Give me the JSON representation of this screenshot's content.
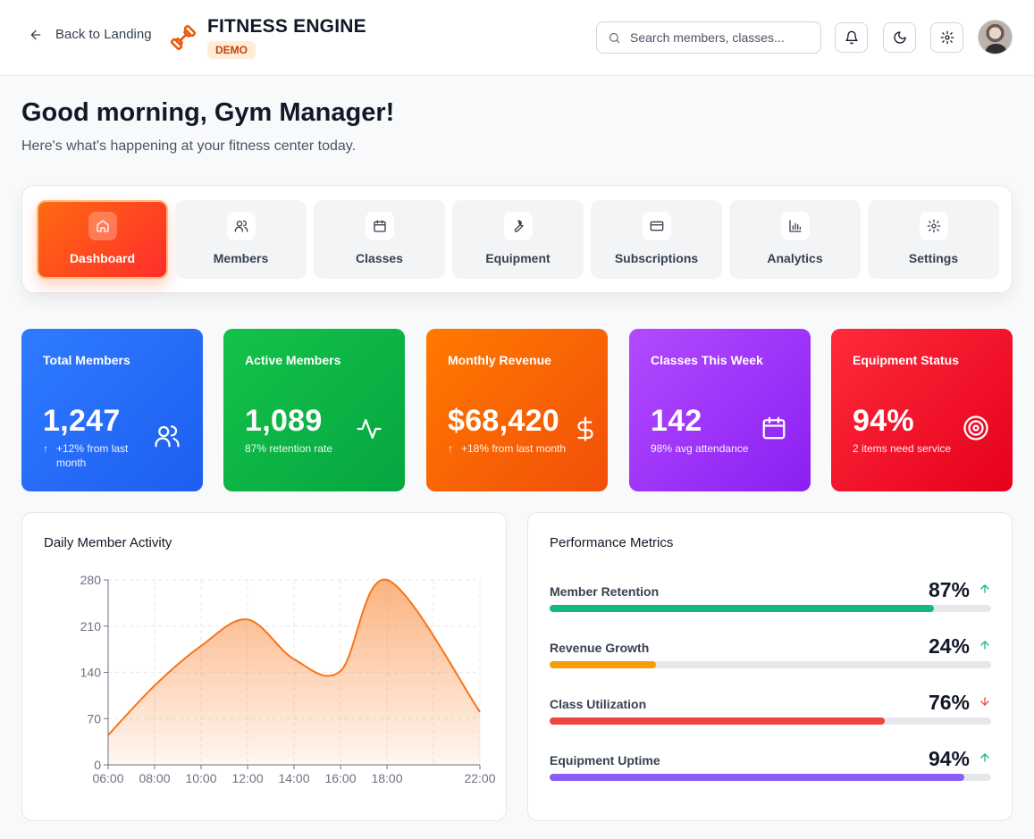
{
  "header": {
    "back_label": "Back to Landing",
    "brand_name": "FITNESS ENGINE",
    "badge": "DEMO",
    "search_placeholder": "Search members, classes...",
    "icons": [
      "bell-icon",
      "moon-icon",
      "gear-icon"
    ]
  },
  "greeting": {
    "title": "Good morning, Gym Manager!",
    "subtitle": "Here's what's happening at your fitness center today."
  },
  "tabs": [
    {
      "label": "Dashboard",
      "icon": "home-icon",
      "active": true
    },
    {
      "label": "Members",
      "icon": "users-icon",
      "active": false
    },
    {
      "label": "Classes",
      "icon": "calendar-icon",
      "active": false
    },
    {
      "label": "Equipment",
      "icon": "wrench-icon",
      "active": false
    },
    {
      "label": "Subscriptions",
      "icon": "credit-card-icon",
      "active": false
    },
    {
      "label": "Analytics",
      "icon": "bar-chart-icon",
      "active": false
    },
    {
      "label": "Settings",
      "icon": "gear-icon",
      "active": false
    }
  ],
  "stats": [
    {
      "title": "Total Members",
      "value": "1,247",
      "sub": "+12% from last month",
      "icon": "users-icon",
      "colors": [
        "#2f7bff",
        "#1d5ef0"
      ]
    },
    {
      "title": "Active Members",
      "value": "1,089",
      "sub": "87% retention rate",
      "icon": "activity-icon",
      "colors": [
        "#14c24a",
        "#05a640"
      ]
    },
    {
      "title": "Monthly Revenue",
      "value": "$68,420",
      "sub": "+18% from last month",
      "icon": "dollar-icon",
      "colors": [
        "#ff7a00",
        "#f24f09"
      ]
    },
    {
      "title": "Classes This Week",
      "value": "142",
      "sub": "98% avg attendance",
      "icon": "calendar-icon",
      "colors": [
        "#b24bff",
        "#8b1ff2"
      ]
    },
    {
      "title": "Equipment Status",
      "value": "94%",
      "sub": "2 items need service",
      "icon": "target-icon",
      "colors": [
        "#ff2a3a",
        "#e6001c"
      ]
    }
  ],
  "activity": {
    "title": "Daily Member Activity"
  },
  "chart_data": {
    "type": "area",
    "title": "Daily Member Activity",
    "xlabel": "",
    "ylabel": "",
    "x": [
      "06:00",
      "08:00",
      "10:00",
      "12:00",
      "14:00",
      "16:00",
      "18:00",
      "22:00"
    ],
    "x_hours": [
      6,
      8,
      10,
      12,
      14,
      16,
      18,
      22
    ],
    "values": [
      45,
      120,
      180,
      220,
      160,
      142,
      280,
      80
    ],
    "y_ticks": [
      0,
      70,
      140,
      210,
      280
    ],
    "x_ticks": [
      "06:00",
      "08:00",
      "10:00",
      "12:00",
      "14:00",
      "16:00",
      "18:00",
      "22:00"
    ],
    "ylim": [
      0,
      280
    ],
    "grid": true,
    "color": "#f97316"
  },
  "metrics": {
    "title": "Performance Metrics",
    "items": [
      {
        "label": "Member Retention",
        "value": "87%",
        "pct": 87,
        "trend": "up",
        "color": "#10b981"
      },
      {
        "label": "Revenue Growth",
        "value": "24%",
        "pct": 24,
        "trend": "up",
        "color": "#f59e0b"
      },
      {
        "label": "Class Utilization",
        "value": "76%",
        "pct": 76,
        "trend": "down",
        "color": "#ef4444"
      },
      {
        "label": "Equipment Uptime",
        "value": "94%",
        "pct": 94,
        "trend": "up",
        "color": "#8b5cf6"
      }
    ]
  }
}
